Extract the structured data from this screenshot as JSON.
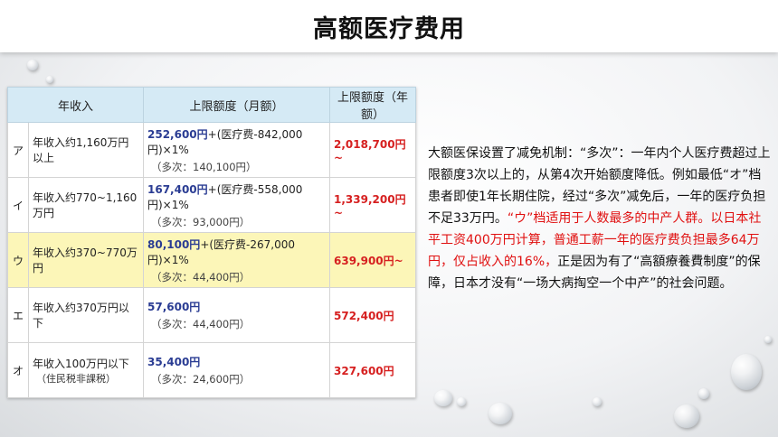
{
  "title": "高额医疗费用",
  "table": {
    "headers": [
      "年收入",
      "上限额度（月额）",
      "上限额度（年额）"
    ],
    "rows": [
      {
        "code": "ア",
        "income": "年收入约1,160万円以上",
        "income_note": "",
        "formula_main": "252,600円",
        "formula_rest": "+(医疗费-842,000円)×1%",
        "formula_sub": "（多次：140,100円）",
        "annual": "2,018,700円~",
        "highlight": false
      },
      {
        "code": "イ",
        "income": "年收入约770~1,160万円",
        "income_note": "",
        "formula_main": "167,400円",
        "formula_rest": "+(医疗费-558,000円)×1%",
        "formula_sub": "（多次：93,000円）",
        "annual": "1,339,200円~",
        "highlight": false
      },
      {
        "code": "ウ",
        "income": "年收入约370~770万円",
        "income_note": "",
        "formula_main": "80,100円",
        "formula_rest": "+(医疗费-267,000円)×1%",
        "formula_sub": "（多次：44,400円）",
        "annual": "639,900円~",
        "highlight": true
      },
      {
        "code": "エ",
        "income": "年收入约370万円以下",
        "income_note": "",
        "formula_main": "57,600円",
        "formula_rest": "",
        "formula_sub": "（多次：44,400円）",
        "annual": "572,400円",
        "highlight": false
      },
      {
        "code": "オ",
        "income": "年收入100万円以下",
        "income_note": "（住民税非課税）",
        "formula_main": "35,400円",
        "formula_rest": "",
        "formula_sub": "（多次：24,600円）",
        "annual": "327,600円",
        "highlight": false
      }
    ]
  },
  "description": {
    "part1": "大额医保设置了减免机制：“多次”：一年内个人医疗费超过上限额度3次以上的，从第4次开始额度降低。例如最低“オ”档患者即使1年长期住院，经过“多次”减免后，一年的医疗负担不足33万円。",
    "part2_red": "“ウ”档适用于人数最多的中产人群。以日本社平工资400万円计算，普通工薪一年的医疗费负担最多64万円，仅占收入的16%，",
    "part3": "正是因为有了“高額療養費制度”的保障，日本才没有“一场大病掏空一个中产”的社会问题。"
  },
  "colors": {
    "accent_red": "#e01010",
    "header_blue": "#d5eaf5",
    "highlight_yellow": "#fcf6b8",
    "formula_blue": "#2a3c93"
  }
}
